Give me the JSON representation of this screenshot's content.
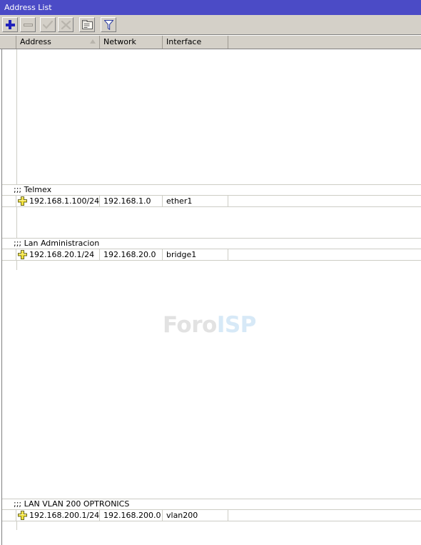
{
  "window": {
    "title": "Address List"
  },
  "toolbar": {
    "buttons": [
      {
        "name": "add-button",
        "icon": "plus-icon",
        "label": "Add",
        "enabled": true
      },
      {
        "name": "remove-button",
        "icon": "minus-icon",
        "label": "Remove",
        "enabled": false
      },
      {
        "name": "enable-button",
        "icon": "check-icon",
        "label": "Enable",
        "enabled": false
      },
      {
        "name": "disable-button",
        "icon": "cross-icon",
        "label": "Disable",
        "enabled": false
      },
      {
        "name": "comment-button",
        "icon": "comment-icon",
        "label": "Comment",
        "enabled": true
      },
      {
        "name": "filter-button",
        "icon": "filter-icon",
        "label": "Filter",
        "enabled": true
      }
    ]
  },
  "table": {
    "columns": [
      {
        "key": "gutter",
        "label": ""
      },
      {
        "key": "address",
        "label": "Address",
        "sorted": "asc"
      },
      {
        "key": "network",
        "label": "Network"
      },
      {
        "key": "interface",
        "label": "Interface"
      },
      {
        "key": "rest",
        "label": ""
      }
    ],
    "groups": [
      {
        "comment": ";;; Telmex",
        "rows": [
          {
            "icon": "address-enabled-icon",
            "address": "192.168.1.100/24",
            "network": "192.168.1.0",
            "interface": "ether1"
          }
        ]
      },
      {
        "comment": ";;; Lan Administracion",
        "rows": [
          {
            "icon": "address-enabled-icon",
            "address": "192.168.20.1/24",
            "network": "192.168.20.0",
            "interface": "bridge1"
          }
        ]
      },
      {
        "comment": ";;; LAN VLAN 200 OPTRONICS",
        "rows": [
          {
            "icon": "address-enabled-icon",
            "address": "192.168.200.1/24",
            "network": "192.168.200.0",
            "interface": "vlan200"
          }
        ]
      }
    ]
  },
  "watermark": {
    "part1": "Foro",
    "part2": "ISP"
  },
  "colors": {
    "titlebar": "#4b4bc6",
    "chrome": "#d4d0c8",
    "grid_line": "#cdcdc5",
    "accent_plus": "#2222bb",
    "address_icon": "#f2e13c",
    "watermark_gray": "#e2e2e2",
    "watermark_blue": "#d7e9f7"
  }
}
